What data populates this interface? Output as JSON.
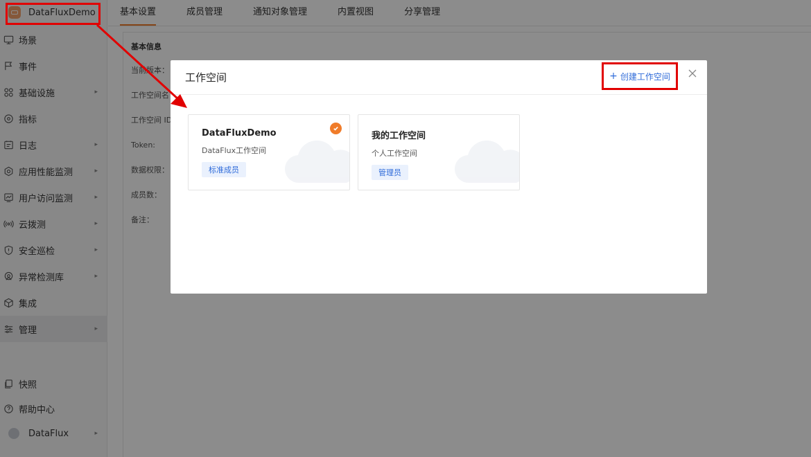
{
  "workspace": {
    "name": "DataFluxDemo"
  },
  "nav": {
    "items": [
      {
        "label": "场景",
        "icon": "monitor-icon",
        "has_arrow": false
      },
      {
        "label": "事件",
        "icon": "flag-icon",
        "has_arrow": false
      },
      {
        "label": "基础设施",
        "icon": "grid-icon",
        "has_arrow": true
      },
      {
        "label": "指标",
        "icon": "target-icon",
        "has_arrow": false
      },
      {
        "label": "日志",
        "icon": "log-icon",
        "has_arrow": true
      },
      {
        "label": "应用性能监测",
        "icon": "gear-icon",
        "has_arrow": true
      },
      {
        "label": "用户访问监测",
        "icon": "chart-icon",
        "has_arrow": true
      },
      {
        "label": "云拨测",
        "icon": "signal-icon",
        "has_arrow": true
      },
      {
        "label": "安全巡检",
        "icon": "shield-icon",
        "has_arrow": true
      },
      {
        "label": "异常检测库",
        "icon": "radar-icon",
        "has_arrow": true
      },
      {
        "label": "集成",
        "icon": "cube-icon",
        "has_arrow": false
      },
      {
        "label": "管理",
        "icon": "sliders-icon",
        "has_arrow": true
      }
    ],
    "bottom": {
      "snapshot": "快照",
      "help": "帮助中心",
      "user": "DataFlux"
    }
  },
  "tabs": [
    "基本设置",
    "成员管理",
    "通知对象管理",
    "内置视图",
    "分享管理"
  ],
  "basic_info": {
    "section_title": "基本信息",
    "rows": [
      "当前版本：",
      "工作空间名",
      "工作空间 ID",
      "Token:",
      "数据权限：",
      "成员数：",
      "备注："
    ]
  },
  "modal": {
    "title": "工作空间",
    "create_label": "创建工作空间",
    "cards": [
      {
        "name": "DataFluxDemo",
        "desc": "DataFlux工作空间",
        "role": "标准成员",
        "selected": true
      },
      {
        "name": "我的工作空间",
        "desc": "个人工作空间",
        "role": "管理员",
        "selected": false
      }
    ]
  },
  "colors": {
    "accent": "#f07c2a",
    "link": "#2f6bd9",
    "highlight": "#e10000"
  }
}
